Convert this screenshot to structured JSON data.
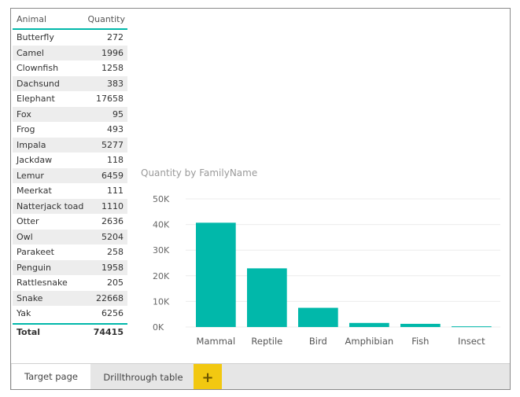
{
  "table": {
    "headers": [
      "Animal",
      "Quantity"
    ],
    "rows": [
      {
        "animal": "Butterfly",
        "quantity": "272"
      },
      {
        "animal": "Camel",
        "quantity": "1996"
      },
      {
        "animal": "Clownfish",
        "quantity": "1258"
      },
      {
        "animal": "Dachsund",
        "quantity": "383"
      },
      {
        "animal": "Elephant",
        "quantity": "17658"
      },
      {
        "animal": "Fox",
        "quantity": "95"
      },
      {
        "animal": "Frog",
        "quantity": "493"
      },
      {
        "animal": "Impala",
        "quantity": "5277"
      },
      {
        "animal": "Jackdaw",
        "quantity": "118"
      },
      {
        "animal": "Lemur",
        "quantity": "6459"
      },
      {
        "animal": "Meerkat",
        "quantity": "111"
      },
      {
        "animal": "Natterjack toad",
        "quantity": "1110"
      },
      {
        "animal": "Otter",
        "quantity": "2636"
      },
      {
        "animal": "Owl",
        "quantity": "5204"
      },
      {
        "animal": "Parakeet",
        "quantity": "258"
      },
      {
        "animal": "Penguin",
        "quantity": "1958"
      },
      {
        "animal": "Rattlesnake",
        "quantity": "205"
      },
      {
        "animal": "Snake",
        "quantity": "22668"
      },
      {
        "animal": "Yak",
        "quantity": "6256"
      }
    ],
    "total_label": "Total",
    "total_value": "74415",
    "accent": "#01b8aa"
  },
  "chart_data": {
    "type": "bar",
    "title": "Quantity by FamilyName",
    "categories": [
      "Mammal",
      "Reptile",
      "Bird",
      "Amphibian",
      "Fish",
      "Insect"
    ],
    "values": [
      40700,
      22900,
      7500,
      1600,
      1250,
      270
    ],
    "ylim": [
      0,
      50000
    ],
    "yticks": [
      0,
      10000,
      20000,
      30000,
      40000,
      50000
    ],
    "ytick_labels": [
      "0K",
      "10K",
      "20K",
      "30K",
      "40K",
      "50K"
    ],
    "grid": true,
    "bar_color": "#01b8aa"
  },
  "tabs": {
    "items": [
      "Target page",
      "Drillthrough table"
    ],
    "add_label": "+",
    "active_color": "#f2c811"
  }
}
